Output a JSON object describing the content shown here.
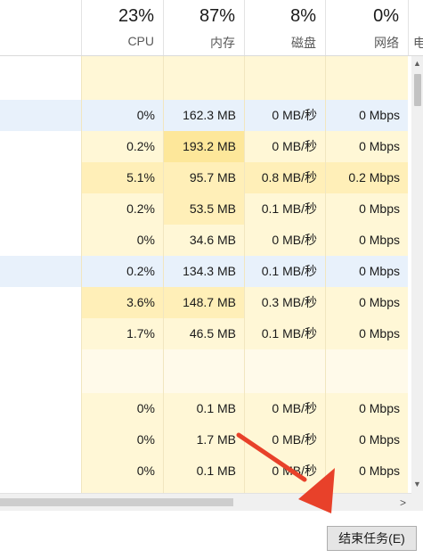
{
  "header": {
    "columns": [
      {
        "id": "cpu",
        "pct": "23%",
        "label": "CPU"
      },
      {
        "id": "memory",
        "pct": "87%",
        "label": "内存"
      },
      {
        "id": "disk",
        "pct": "8%",
        "label": "磁盘"
      },
      {
        "id": "network",
        "pct": "0%",
        "label": "网络"
      }
    ],
    "partial_label": "电"
  },
  "rows": [
    {
      "cpu": "0%",
      "memory": "162.3 MB",
      "disk": "0 MB/秒",
      "network": "0 Mbps",
      "selected": true
    },
    {
      "cpu": "0.2%",
      "memory": "193.2 MB",
      "disk": "0 MB/秒",
      "network": "0 Mbps"
    },
    {
      "cpu": "5.1%",
      "memory": "95.7 MB",
      "disk": "0.8 MB/秒",
      "network": "0.2 Mbps"
    },
    {
      "cpu": "0.2%",
      "memory": "53.5 MB",
      "disk": "0.1 MB/秒",
      "network": "0 Mbps"
    },
    {
      "cpu": "0%",
      "memory": "34.6 MB",
      "disk": "0 MB/秒",
      "network": "0 Mbps"
    },
    {
      "cpu": "0.2%",
      "memory": "134.3 MB",
      "disk": "0.1 MB/秒",
      "network": "0 Mbps",
      "selected": true
    },
    {
      "cpu": "3.6%",
      "memory": "148.7 MB",
      "disk": "0.3 MB/秒",
      "network": "0 Mbps"
    },
    {
      "cpu": "1.7%",
      "memory": "46.5 MB",
      "disk": "0.1 MB/秒",
      "network": "0 Mbps"
    },
    {
      "cpu": "",
      "memory": "",
      "disk": "",
      "network": "",
      "group_gap": true
    },
    {
      "cpu": "0%",
      "memory": "0.1 MB",
      "disk": "0 MB/秒",
      "network": "0 Mbps"
    },
    {
      "cpu": "0%",
      "memory": "1.7 MB",
      "disk": "0 MB/秒",
      "network": "0 Mbps"
    },
    {
      "cpu": "0%",
      "memory": "0.1 MB",
      "disk": "0 MB/秒",
      "network": "0 Mbps"
    }
  ],
  "scrollbars": {
    "vertical_up_icon": "chevron-up-icon",
    "vertical_down_icon": "chevron-down-icon",
    "horizontal_right_icon": "chevron-right-icon"
  },
  "footer": {
    "end_task_label": "结束任务(E)"
  },
  "annotation": {
    "arrow_color": "#e8412a"
  },
  "colors": {
    "heat_light": "#fff7d6",
    "heat_medium": "#ffefb8",
    "heat_strong": "#fde79a",
    "selected_row": "#e8f1fb"
  }
}
